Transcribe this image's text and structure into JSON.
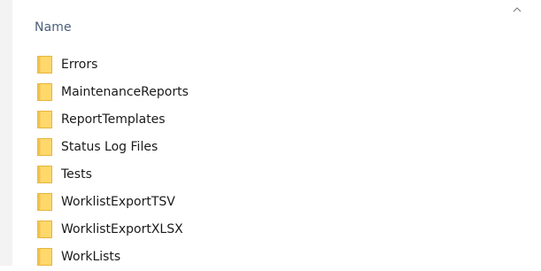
{
  "column_header": {
    "label": "Name",
    "sort_icon": "chevron-up-icon"
  },
  "files": [
    {
      "name": "Errors",
      "icon": "folder-icon"
    },
    {
      "name": "MaintenanceReports",
      "icon": "folder-icon"
    },
    {
      "name": "ReportTemplates",
      "icon": "folder-icon"
    },
    {
      "name": "Status Log Files",
      "icon": "folder-icon"
    },
    {
      "name": "Tests",
      "icon": "folder-icon"
    },
    {
      "name": "WorklistExportTSV",
      "icon": "folder-icon"
    },
    {
      "name": "WorklistExportXLSX",
      "icon": "folder-icon"
    },
    {
      "name": "WorkLists",
      "icon": "folder-icon"
    }
  ],
  "colors": {
    "folder_fill": "#ffd86b",
    "folder_edge": "#e6b43a",
    "header_text": "#4c607a",
    "item_text": "#1a1a1a",
    "gutter": "#f3f3f3"
  }
}
